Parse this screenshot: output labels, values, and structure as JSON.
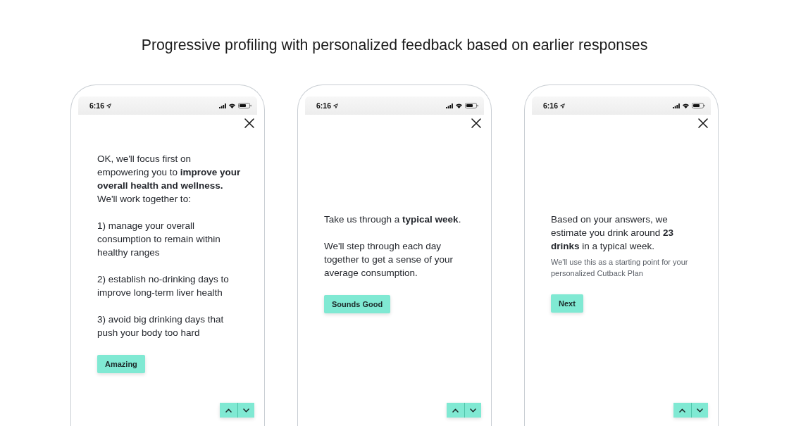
{
  "title": "Progressive profiling with personalized feedback based on earlier responses",
  "phones": [
    {
      "status_bar": {
        "time": "6:16"
      },
      "paragraphs": [
        {
          "kind": "body",
          "text": "OK, we'll focus first on empowering you to **improve your overall health and wellness.** We'll work together to:"
        },
        {
          "kind": "body",
          "text": "1) manage your overall consumption to remain within healthy ranges"
        },
        {
          "kind": "body",
          "text": "2) establish no-drinking days to improve long-term liver health"
        },
        {
          "kind": "body",
          "text": "3) avoid big drinking days that push your body too hard"
        }
      ],
      "button": "Amazing"
    },
    {
      "status_bar": {
        "time": "6:16"
      },
      "paragraphs": [
        {
          "kind": "body",
          "text": "Take us through a **typical week**."
        },
        {
          "kind": "body",
          "text": "We'll step through each day together to get a sense of your average consumption."
        }
      ],
      "button": "Sounds Good"
    },
    {
      "status_bar": {
        "time": "6:16"
      },
      "paragraphs": [
        {
          "kind": "body",
          "text": "Based on your answers, we estimate you drink around **23 drinks** in a typical week."
        },
        {
          "kind": "note",
          "text": "We'll use this as a starting point for your personalized Cutback Plan"
        }
      ],
      "button": "Next"
    }
  ]
}
